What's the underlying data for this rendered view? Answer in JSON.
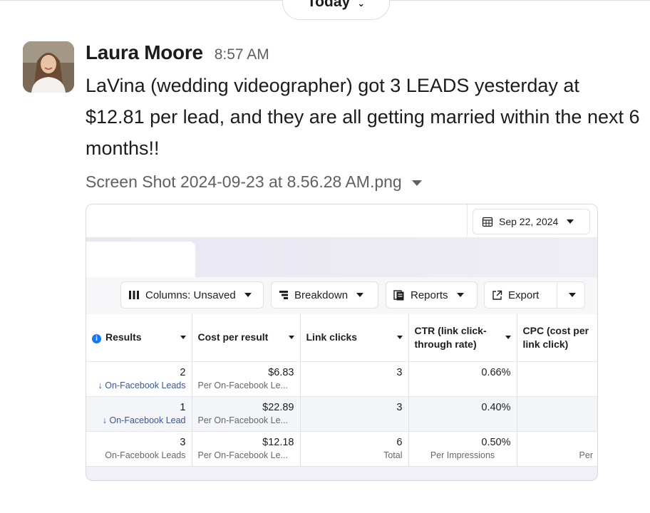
{
  "day_divider": {
    "label": "Today"
  },
  "message": {
    "sender": "Laura Moore",
    "time": "8:57 AM",
    "text": "LaVina (wedding videographer) got 3 LEADS yesterday at $12.81 per lead, and they are all getting married within the next 6 months!!",
    "attachment_name": "Screen Shot 2024-09-23 at 8.56.28 AM.png"
  },
  "screenshot": {
    "date_label": "Sep 22, 2024",
    "toolbar": {
      "columns": "Columns: Unsaved",
      "breakdown": "Breakdown",
      "reports": "Reports",
      "export": "Export"
    },
    "headers": [
      "Results",
      "Cost per result",
      "Link clicks",
      "CTR (link click-through rate)",
      "CPC (cost per link click)"
    ],
    "rows": [
      {
        "results": "2",
        "results_sub": "On-Facebook Leads",
        "cost": "$6.83",
        "cost_sub": "Per On-Facebook Le...",
        "clicks": "3",
        "ctr": "0.66%"
      },
      {
        "results": "1",
        "results_sub": "On-Facebook Lead",
        "cost": "$22.89",
        "cost_sub": "Per On-Facebook Le...",
        "clicks": "3",
        "ctr": "0.40%"
      }
    ],
    "total": {
      "results": "3",
      "results_sub": "On-Facebook Leads",
      "cost": "$12.18",
      "cost_sub": "Per On-Facebook Le...",
      "clicks": "6",
      "clicks_sub": "Total",
      "ctr": "0.50%",
      "ctr_sub": "Per Impressions",
      "cpc_sub": "Per"
    }
  }
}
